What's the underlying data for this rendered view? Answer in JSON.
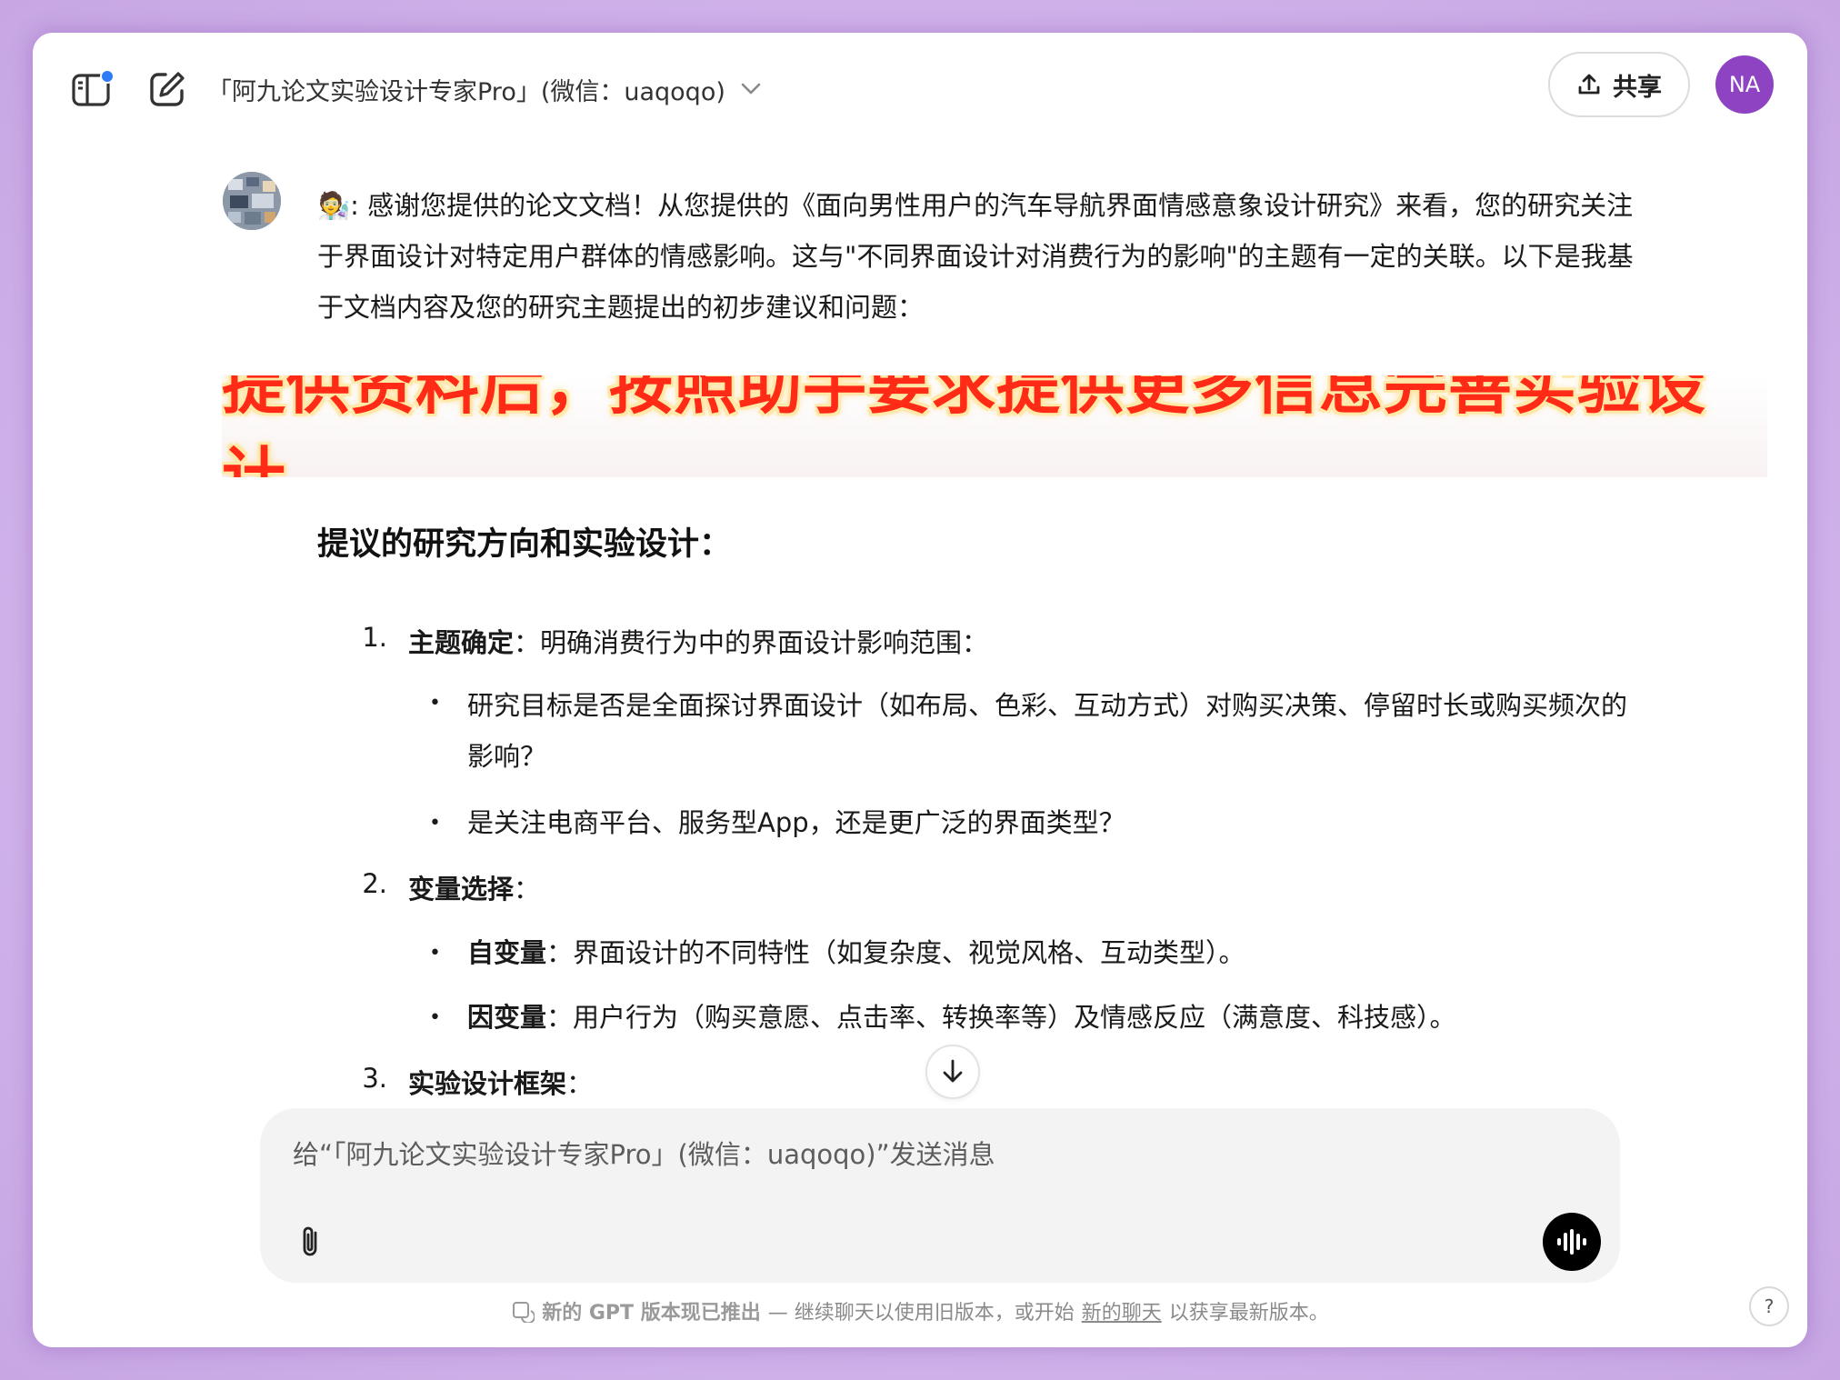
{
  "header": {
    "model_title": "「阿九论文实验设计专家Pro」(微信：uaqoqo)",
    "share_label": "共享",
    "user_initials": "NA",
    "accent": "#8e44c2",
    "notification_dot": "#2f7cf6"
  },
  "message": {
    "intro": "🧑‍🔬: 感谢您提供的论文文档！从您提供的《面向男性用户的汽车导航界面情感意象设计研究》来看，您的研究关注于界面设计对特定用户群体的情感影响。这与\"不同界面设计对消费行为的影响\"的主题有一定的关联。以下是我基于文档内容及您的研究主题提出的初步建议和问题："
  },
  "banner": {
    "text": "提供资料后，按照助手要求提供更多信息完善实验设计"
  },
  "section": {
    "heading": "提议的研究方向和实验设计：",
    "items": [
      {
        "num": "1.",
        "bold": "主题确定",
        "rest": "：明确消费行为中的界面设计影响范围：",
        "bullets": [
          {
            "bold": "",
            "text": "研究目标是否是全面探讨界面设计（如布局、色彩、互动方式）对购买决策、停留时长或购买频次的影响？"
          },
          {
            "bold": "",
            "text": "是关注电商平台、服务型App，还是更广泛的界面类型？"
          }
        ]
      },
      {
        "num": "2.",
        "bold": "变量选择",
        "rest": "：",
        "bullets": [
          {
            "bold": "自变量",
            "text": "：界面设计的不同特性（如复杂度、视觉风格、互动类型）。"
          },
          {
            "bold": "因变量",
            "text": "：用户行为（购买意愿、点击率、转换率等）及情感反应（满意度、科技感）。"
          }
        ]
      },
      {
        "num": "3.",
        "bold": "实验设计框架",
        "rest": "：",
        "bullets": []
      }
    ]
  },
  "composer": {
    "placeholder": "给“「阿九论文实验设计专家Pro」(微信：uaqoqo)”发送消息"
  },
  "footer": {
    "bold": "新的 GPT 版本现已推出",
    "text_before_link": " — 继续聊天以使用旧版本，或开始",
    "link": "新的聊天",
    "text_after_link": "以获享最新版本。",
    "help": "?"
  }
}
